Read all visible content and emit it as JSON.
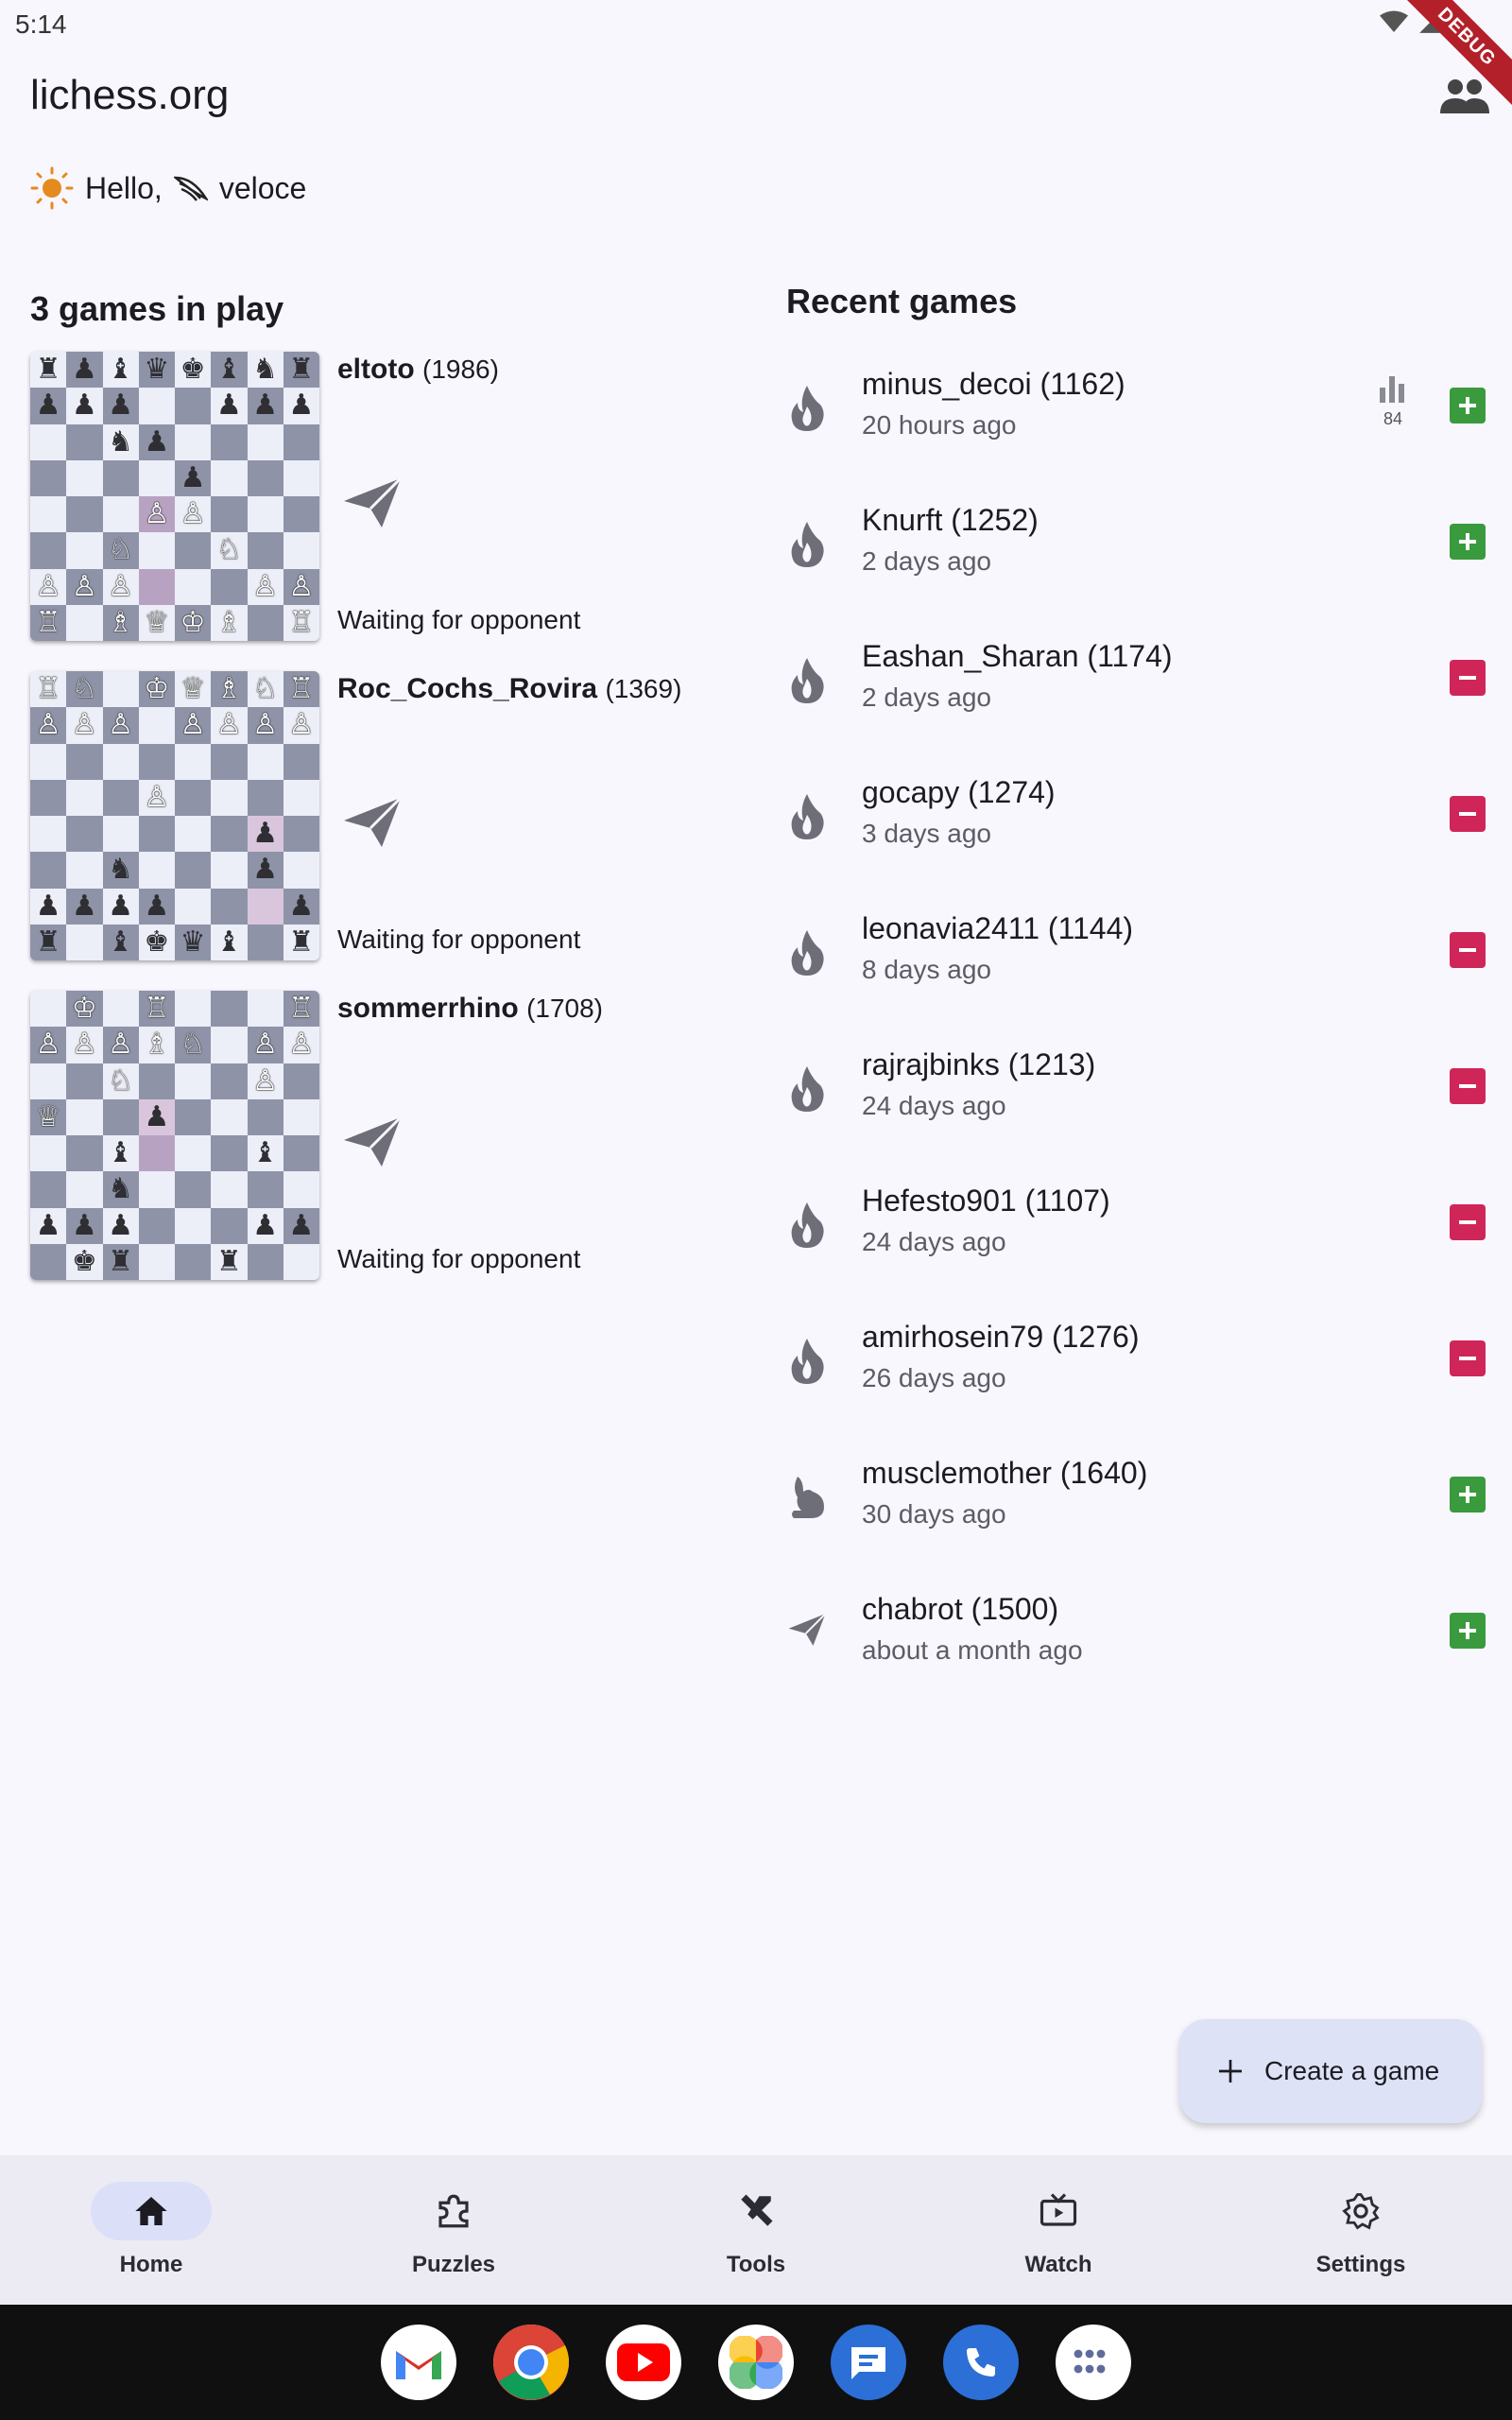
{
  "status_bar": {
    "time": "5:14",
    "debug_label": "DEBUG"
  },
  "app_bar": {
    "title": "lichess.org",
    "friends_icon": "people-icon"
  },
  "greeting": {
    "hello": "Hello,",
    "username": "veloce"
  },
  "games_in_play": {
    "title": "3 games in play",
    "games": [
      {
        "opponent": "eltoto",
        "rating": "(1986)",
        "status": "Waiting for opponent",
        "speed_icon": "paper-plane-icon"
      },
      {
        "opponent": "Roc_Cochs_Rovira",
        "rating": "(1369)",
        "status": "Waiting for opponent",
        "speed_icon": "paper-plane-icon"
      },
      {
        "opponent": "sommerrhino",
        "rating": "(1708)",
        "status": "Waiting for opponent",
        "speed_icon": "paper-plane-icon"
      }
    ]
  },
  "recent_games": {
    "title": "Recent games",
    "items": [
      {
        "opponent": "minus_decoi (1162)",
        "time": "20 hours ago",
        "speed": "fire-icon",
        "result": "win",
        "stats_value": "84"
      },
      {
        "opponent": "Knurft (1252)",
        "time": "2 days ago",
        "speed": "fire-icon",
        "result": "win"
      },
      {
        "opponent": "Eashan_Sharan (1174)",
        "time": "2 days ago",
        "speed": "fire-icon",
        "result": "loss"
      },
      {
        "opponent": "gocapy (1274)",
        "time": "3 days ago",
        "speed": "fire-icon",
        "result": "loss"
      },
      {
        "opponent": "leonavia2411 (1144)",
        "time": "8 days ago",
        "speed": "fire-icon",
        "result": "loss"
      },
      {
        "opponent": "rajrajbinks (1213)",
        "time": "24 days ago",
        "speed": "fire-icon",
        "result": "loss"
      },
      {
        "opponent": "Hefesto901 (1107)",
        "time": "24 days ago",
        "speed": "fire-icon",
        "result": "loss"
      },
      {
        "opponent": "amirhosein79 (1276)",
        "time": "26 days ago",
        "speed": "fire-icon",
        "result": "loss"
      },
      {
        "opponent": "musclemother (1640)",
        "time": "30 days ago",
        "speed": "rabbit-icon",
        "result": "win"
      },
      {
        "opponent": "chabrot (1500)",
        "time": "about a month ago",
        "speed": "paper-plane-icon",
        "result": "win"
      }
    ]
  },
  "fab": {
    "label": "Create a game"
  },
  "bottom_nav": [
    {
      "label": "Home",
      "icon": "home-icon",
      "active": true
    },
    {
      "label": "Puzzles",
      "icon": "puzzle-icon",
      "active": false
    },
    {
      "label": "Tools",
      "icon": "tools-icon",
      "active": false
    },
    {
      "label": "Watch",
      "icon": "tv-icon",
      "active": false
    },
    {
      "label": "Settings",
      "icon": "gear-icon",
      "active": false
    }
  ],
  "dock": [
    "gmail-icon",
    "chrome-icon",
    "youtube-icon",
    "photos-icon",
    "messages-icon",
    "phone-icon",
    "app-drawer-icon"
  ],
  "colors": {
    "background": "#f8f7fd",
    "win": "#3a9a3e",
    "loss": "#d02558",
    "nav_active": "#dbe0f8",
    "fab": "#dde2f7",
    "board_light": "#eceef8",
    "board_dark": "#8e93a8"
  },
  "boards": [
    [
      "rpbqkbnr",
      "ppp..ppp",
      "..np....",
      "....p...",
      "...PP...",
      "..N..N..",
      "PPP...PP",
      "R.BQKB.R"
    ],
    [
      "RN.KQBNR",
      "PPP.PPPP",
      "........",
      "...P....",
      "......p.",
      "..n...p.",
      "pppp...p",
      "r.bkqb.r"
    ],
    [
      ".K.R...R",
      "PPPBN.PP",
      "..N...P.",
      "Q..p....",
      "..b...b.",
      "..n.....",
      "ppp...pp",
      ".kr..r.."
    ]
  ],
  "board_highlights": [
    [
      "4-3",
      "6-3"
    ],
    [
      "4-6",
      "6-6"
    ],
    [
      "3-3",
      "4-3"
    ]
  ]
}
